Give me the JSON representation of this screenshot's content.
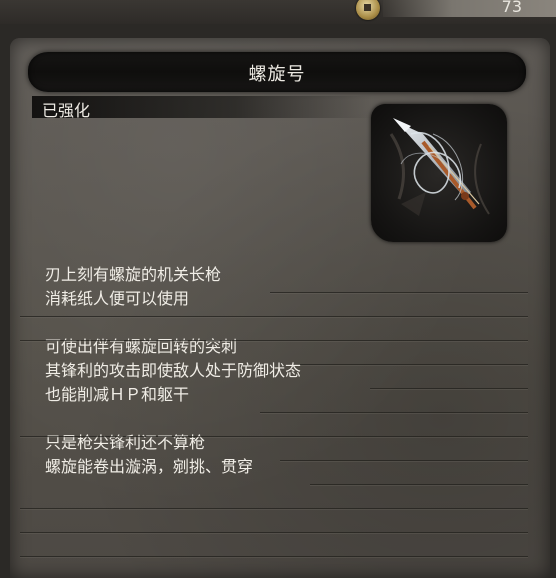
{
  "header": {
    "counter": "73"
  },
  "item": {
    "name": "螺旋号",
    "status": "已强化",
    "description": [
      "刃上刻有螺旋的机关长枪",
      "消耗纸人便可以使用",
      "",
      "可使出伴有螺旋回转的突刺",
      "其锋利的攻击即使敌人处于防御状态",
      "也能削减ＨＰ和躯干",
      "",
      "只是枪尖锋利还不算枪",
      "螺旋能卷出漩涡，剜挑、贯穿"
    ]
  },
  "colors": {
    "panel": "#57534e",
    "title_bar": "#121110",
    "text": "#f0ede6",
    "coin": "#c9b070"
  }
}
